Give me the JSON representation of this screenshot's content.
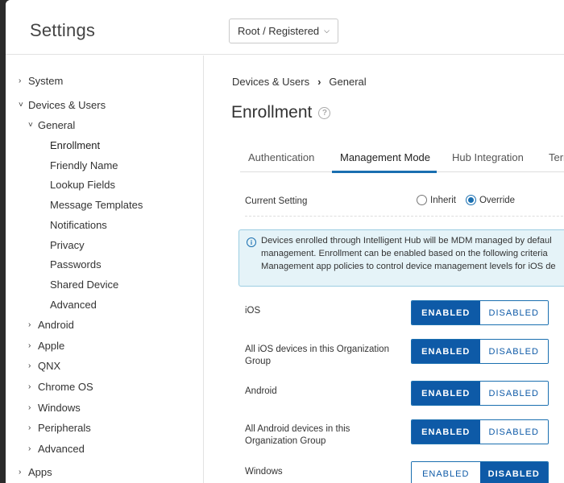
{
  "header": {
    "title": "Settings",
    "org_group": "Root / Registered"
  },
  "sidebar": {
    "items": [
      {
        "label": "System",
        "arrow": "›"
      },
      {
        "label": "Devices & Users",
        "arrow": "˅"
      },
      {
        "label": "General",
        "arrow": "˅"
      },
      {
        "label": "Enrollment"
      },
      {
        "label": "Friendly Name"
      },
      {
        "label": "Lookup Fields"
      },
      {
        "label": "Message Templates"
      },
      {
        "label": "Notifications"
      },
      {
        "label": "Privacy"
      },
      {
        "label": "Passwords"
      },
      {
        "label": "Shared Device"
      },
      {
        "label": "Advanced"
      },
      {
        "label": "Android",
        "arrow": "›"
      },
      {
        "label": "Apple",
        "arrow": "›"
      },
      {
        "label": "QNX",
        "arrow": "›"
      },
      {
        "label": "Chrome OS",
        "arrow": "›"
      },
      {
        "label": "Windows",
        "arrow": "›"
      },
      {
        "label": "Peripherals",
        "arrow": "›"
      },
      {
        "label": "Advanced",
        "arrow": "›"
      },
      {
        "label": "Apps",
        "arrow": "›"
      }
    ]
  },
  "breadcrumb": {
    "parent": "Devices & Users",
    "separator": "›",
    "current": "General"
  },
  "page": {
    "title": "Enrollment",
    "help_glyph": "?"
  },
  "tabs": [
    {
      "label": "Authentication"
    },
    {
      "label": "Management Mode"
    },
    {
      "label": "Hub Integration"
    },
    {
      "label": "Terr"
    }
  ],
  "current_setting": {
    "label": "Current Setting",
    "options": [
      "Inherit",
      "Override"
    ],
    "selected": "Override"
  },
  "info": {
    "icon_glyph": "i",
    "lines": [
      "Devices enrolled through Intelligent Hub will be MDM managed by defaul",
      "management. Enrollment can be enabled based on the following criteria",
      "Management app policies to control device management levels for iOS de"
    ]
  },
  "toggle_labels": {
    "enabled": "ENABLED",
    "disabled": "DISABLED"
  },
  "fields": [
    {
      "label": "iOS",
      "state": "enabled"
    },
    {
      "label": "All iOS devices in this Organization Group",
      "state": "enabled"
    },
    {
      "label": "Android",
      "state": "enabled"
    },
    {
      "label": "All Android devices in this Organization Group",
      "state": "enabled"
    },
    {
      "label": "Windows",
      "state": "disabled"
    }
  ],
  "colors": {
    "accent": "#0e5aa7",
    "info_bg": "#e5f3f8"
  }
}
